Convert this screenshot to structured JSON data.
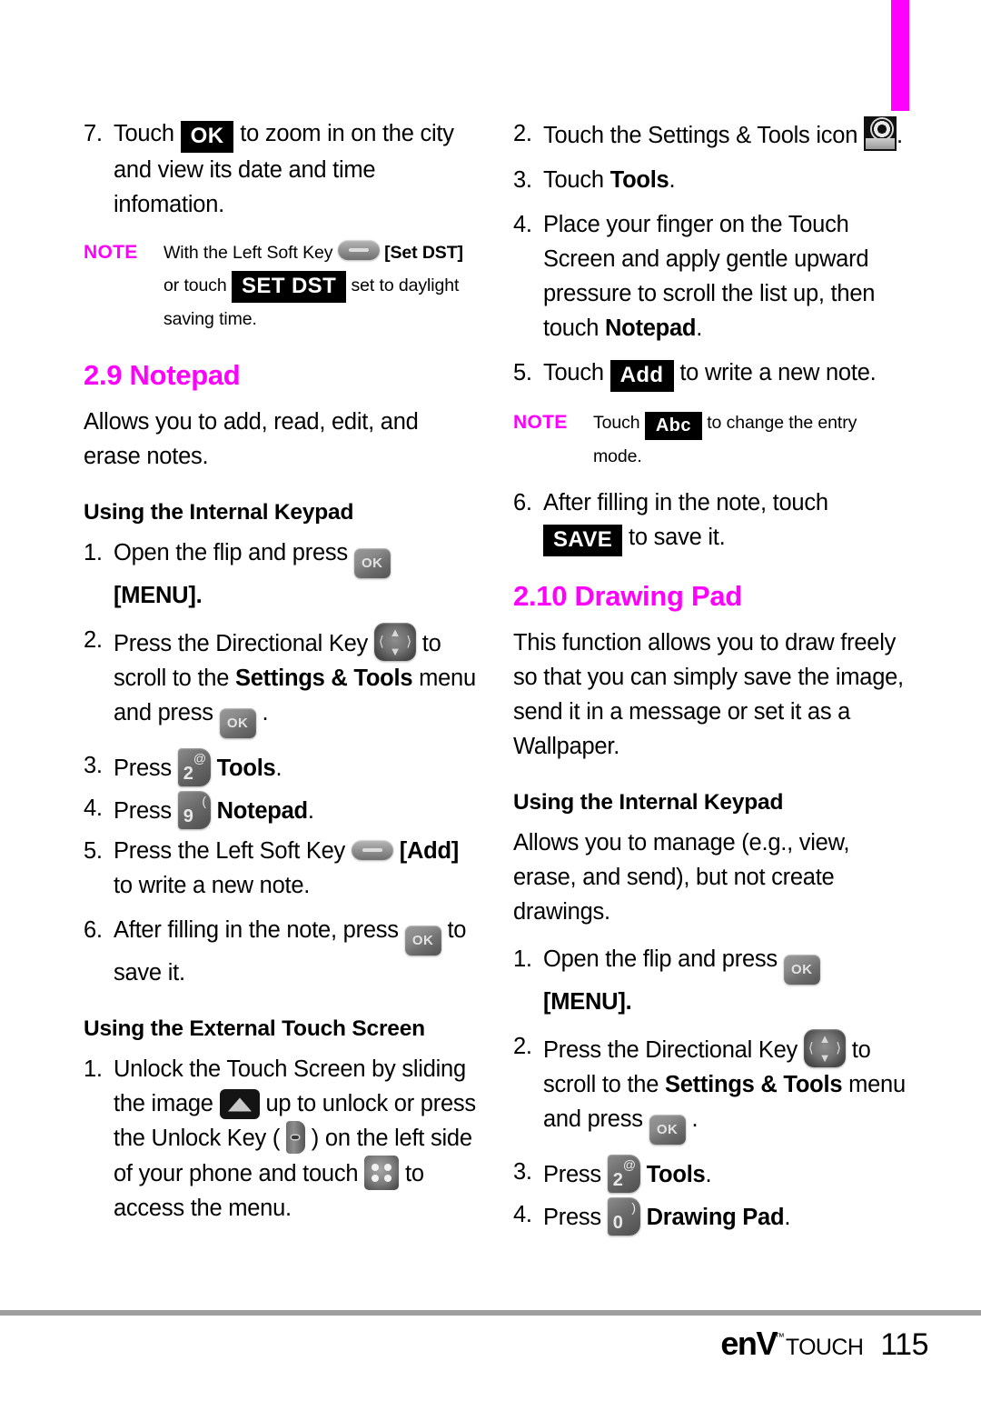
{
  "page": {
    "number": "115",
    "brand_env": "enV",
    "brand_touch": "TOUCH",
    "trademark": "™"
  },
  "edge_tab": {
    "color": "#ff00ff"
  },
  "left_column": {
    "step7": {
      "num": "7.",
      "text_a": "Touch",
      "chip_ok": "OK",
      "text_b": "to zoom in on the city and view its date and time infomation."
    },
    "note1": {
      "tag": "NOTE",
      "text_a": "With the Left Soft Key",
      "bracket_setdst": "[Set DST]",
      "text_b": "or touch",
      "chip_setdst": "SET DST",
      "text_c": "set to daylight saving time."
    },
    "heading_29": "2.9 Notepad",
    "intro": "Allows you to add, read, edit, and erase notes.",
    "sub_internal": "Using the Internal Keypad",
    "internal_steps": {
      "s1": {
        "num": "1.",
        "text_a": "Open the flip and press",
        "key": "OK",
        "text_b": "[MENU]."
      },
      "s2": {
        "num": "2.",
        "text_a": "Press the Directional Key",
        "text_b": "to scroll to the",
        "bold": "Settings & Tools",
        "text_c": "menu and press",
        "key": "OK",
        "text_d": "."
      },
      "s3": {
        "num": "3.",
        "text_a": "Press",
        "key_digit": "2",
        "key_sup": "@",
        "bold": "Tools",
        "text_b": "."
      },
      "s4": {
        "num": "4.",
        "text_a": "Press",
        "key_digit": "9",
        "key_sup": "(",
        "bold": "Notepad",
        "text_b": "."
      },
      "s5": {
        "num": "5.",
        "text_a": "Press the Left Soft Key",
        "bracket": "[Add]",
        "text_b": "to write a new note."
      },
      "s6": {
        "num": "6.",
        "text_a": "After filling in the note, press",
        "key": "OK",
        "text_b": "to save it."
      }
    },
    "sub_external": "Using the External Touch Screen",
    "external_steps": {
      "s1": {
        "num": "1.",
        "text_a": "Unlock the Touch Screen by sliding the image",
        "text_b": "up to unlock or press the Unlock Key",
        "paren_open": "(",
        "paren_close": ")",
        "text_c": "on the left side of your phone and touch",
        "text_d": "to access the menu."
      }
    }
  },
  "right_column": {
    "external_steps": {
      "s2": {
        "num": "2.",
        "text_a": "Touch the Settings & Tools icon",
        "text_b": "."
      },
      "s3": {
        "num": "3.",
        "text_a": "Touch",
        "bold": "Tools",
        "text_b": "."
      },
      "s4": {
        "num": "4.",
        "text_a": "Place your finger on the Touch Screen and apply gentle upward pressure to scroll the list up, then touch",
        "bold": "Notepad",
        "text_b": "."
      },
      "s5": {
        "num": "5.",
        "text_a": "Touch",
        "chip": "Add",
        "text_b": "to write a new note."
      }
    },
    "note2": {
      "tag": "NOTE",
      "text_a": "Touch",
      "chip": "Abc",
      "text_b": "to change the entry mode."
    },
    "step6": {
      "num": "6.",
      "text_a": "After filling in the note, touch",
      "chip": "SAVE",
      "text_b": "to save it."
    },
    "heading_210": "2.10 Drawing Pad",
    "intro": "This function allows you to draw freely so that you can simply save the image, send it in a message or set it as a Wallpaper.",
    "sub_internal": "Using the Internal Keypad",
    "intro2": "Allows you to manage (e.g., view, erase, and send), but not create drawings.",
    "internal_steps": {
      "s1": {
        "num": "1.",
        "text_a": "Open the flip and press",
        "key": "OK",
        "text_b": "[MENU]."
      },
      "s2": {
        "num": "2.",
        "text_a": "Press the Directional Key",
        "text_b": "to scroll to the",
        "bold": "Settings & Tools",
        "text_c": "menu and press",
        "key": "OK",
        "text_d": "."
      },
      "s3": {
        "num": "3.",
        "text_a": "Press",
        "key_digit": "2",
        "key_sup": "@",
        "bold": "Tools",
        "text_b": "."
      },
      "s4": {
        "num": "4.",
        "text_a": "Press",
        "key_digit": "0",
        "key_sup": ")",
        "bold": "Drawing Pad",
        "text_b": "."
      }
    }
  }
}
